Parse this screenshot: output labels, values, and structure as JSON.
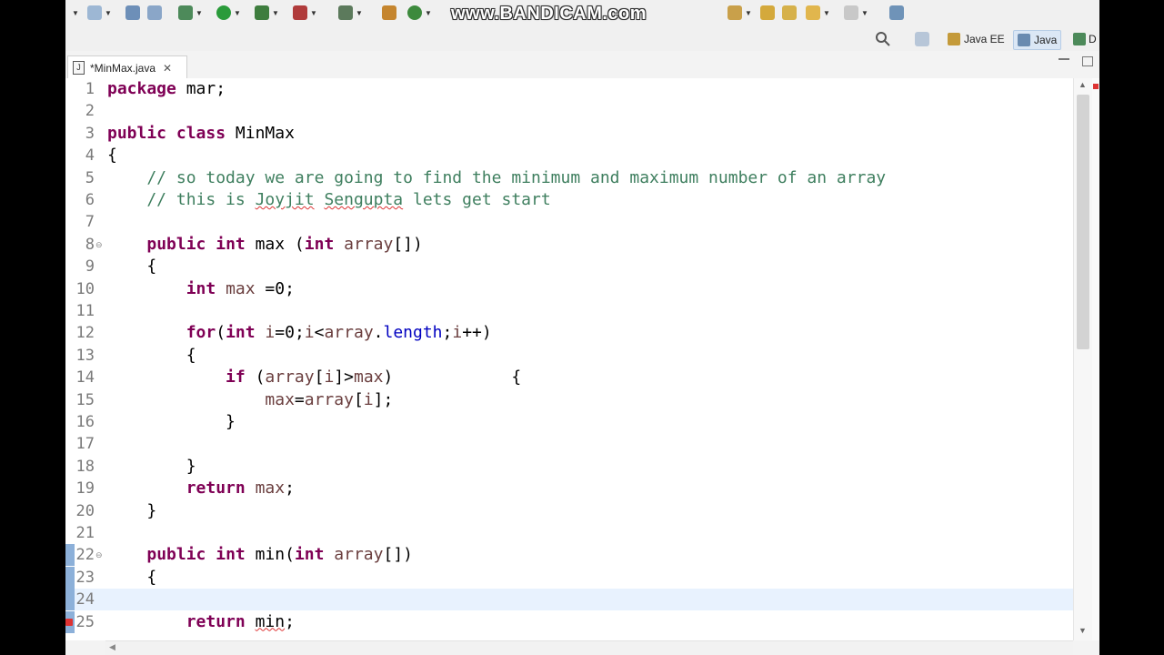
{
  "watermark": "www.BANDICAM.com",
  "perspectives": [
    {
      "label": "Java EE",
      "active": false
    },
    {
      "label": "Java",
      "active": true
    },
    {
      "label": "D",
      "active": false
    }
  ],
  "editor_tab": {
    "label": "*MinMax.java",
    "close": "✕",
    "file_glyph": "J"
  },
  "code_lines": [
    {
      "n": "1",
      "tokens": [
        {
          "t": "package",
          "c": "kw"
        },
        {
          "t": " mar;"
        }
      ]
    },
    {
      "n": "2",
      "tokens": []
    },
    {
      "n": "3",
      "tokens": [
        {
          "t": "public",
          "c": "kw"
        },
        {
          "t": " "
        },
        {
          "t": "class",
          "c": "kw"
        },
        {
          "t": " MinMax"
        }
      ]
    },
    {
      "n": "4",
      "tokens": [
        {
          "t": "{"
        }
      ]
    },
    {
      "n": "5",
      "tokens": [
        {
          "t": "    // so today we are going to find the minimum and maximum number of an array",
          "c": "cm"
        }
      ]
    },
    {
      "n": "6",
      "tokens": [
        {
          "t": "    // this is ",
          "c": "cm"
        },
        {
          "t": "Joyjit",
          "c": "cm sq"
        },
        {
          "t": " ",
          "c": "cm"
        },
        {
          "t": "Sengupta",
          "c": "cm sq"
        },
        {
          "t": " lets get start",
          "c": "cm"
        }
      ]
    },
    {
      "n": "7",
      "tokens": []
    },
    {
      "n": "8",
      "fold": true,
      "tokens": [
        {
          "t": "    "
        },
        {
          "t": "public",
          "c": "kw"
        },
        {
          "t": " "
        },
        {
          "t": "int",
          "c": "kw"
        },
        {
          "t": " max ("
        },
        {
          "t": "int",
          "c": "kw"
        },
        {
          "t": " "
        },
        {
          "t": "array",
          "c": "var"
        },
        {
          "t": "[])"
        }
      ]
    },
    {
      "n": "9",
      "tokens": [
        {
          "t": "    {"
        }
      ]
    },
    {
      "n": "10",
      "tokens": [
        {
          "t": "        "
        },
        {
          "t": "int",
          "c": "kw"
        },
        {
          "t": " "
        },
        {
          "t": "max",
          "c": "var"
        },
        {
          "t": " =0;"
        }
      ]
    },
    {
      "n": "11",
      "tokens": []
    },
    {
      "n": "12",
      "tokens": [
        {
          "t": "        "
        },
        {
          "t": "for",
          "c": "kw"
        },
        {
          "t": "("
        },
        {
          "t": "int",
          "c": "kw"
        },
        {
          "t": " "
        },
        {
          "t": "i",
          "c": "var"
        },
        {
          "t": "=0;"
        },
        {
          "t": "i",
          "c": "var"
        },
        {
          "t": "<"
        },
        {
          "t": "array",
          "c": "var"
        },
        {
          "t": "."
        },
        {
          "t": "length",
          "c": "fld"
        },
        {
          "t": ";"
        },
        {
          "t": "i",
          "c": "var"
        },
        {
          "t": "++)"
        }
      ]
    },
    {
      "n": "13",
      "tokens": [
        {
          "t": "        {"
        }
      ]
    },
    {
      "n": "14",
      "tokens": [
        {
          "t": "            "
        },
        {
          "t": "if",
          "c": "kw"
        },
        {
          "t": " ("
        },
        {
          "t": "array",
          "c": "var"
        },
        {
          "t": "["
        },
        {
          "t": "i",
          "c": "var"
        },
        {
          "t": "]>"
        },
        {
          "t": "max",
          "c": "var"
        },
        {
          "t": ")            {"
        }
      ]
    },
    {
      "n": "15",
      "tokens": [
        {
          "t": "                "
        },
        {
          "t": "max",
          "c": "var"
        },
        {
          "t": "="
        },
        {
          "t": "array",
          "c": "var"
        },
        {
          "t": "["
        },
        {
          "t": "i",
          "c": "var"
        },
        {
          "t": "];"
        }
      ]
    },
    {
      "n": "16",
      "tokens": [
        {
          "t": "            }"
        }
      ]
    },
    {
      "n": "17",
      "tokens": []
    },
    {
      "n": "18",
      "tokens": [
        {
          "t": "        }"
        }
      ]
    },
    {
      "n": "19",
      "tokens": [
        {
          "t": "        "
        },
        {
          "t": "return",
          "c": "kw"
        },
        {
          "t": " "
        },
        {
          "t": "max",
          "c": "var"
        },
        {
          "t": ";"
        }
      ]
    },
    {
      "n": "20",
      "tokens": [
        {
          "t": "    }"
        }
      ]
    },
    {
      "n": "21",
      "tokens": []
    },
    {
      "n": "22",
      "fold": true,
      "marker": true,
      "tokens": [
        {
          "t": "    "
        },
        {
          "t": "public",
          "c": "kw"
        },
        {
          "t": " "
        },
        {
          "t": "int",
          "c": "kw"
        },
        {
          "t": " min("
        },
        {
          "t": "int",
          "c": "kw"
        },
        {
          "t": " "
        },
        {
          "t": "array",
          "c": "var"
        },
        {
          "t": "[])"
        }
      ]
    },
    {
      "n": "23",
      "marker": true,
      "tokens": [
        {
          "t": "    {"
        }
      ]
    },
    {
      "n": "24",
      "marker": true,
      "current": true,
      "tokens": []
    },
    {
      "n": "25",
      "marker": true,
      "error": true,
      "tokens": [
        {
          "t": "        "
        },
        {
          "t": "return",
          "c": "kw"
        },
        {
          "t": " "
        },
        {
          "t": "min",
          "c": "sq"
        },
        {
          "t": ";"
        }
      ]
    }
  ]
}
